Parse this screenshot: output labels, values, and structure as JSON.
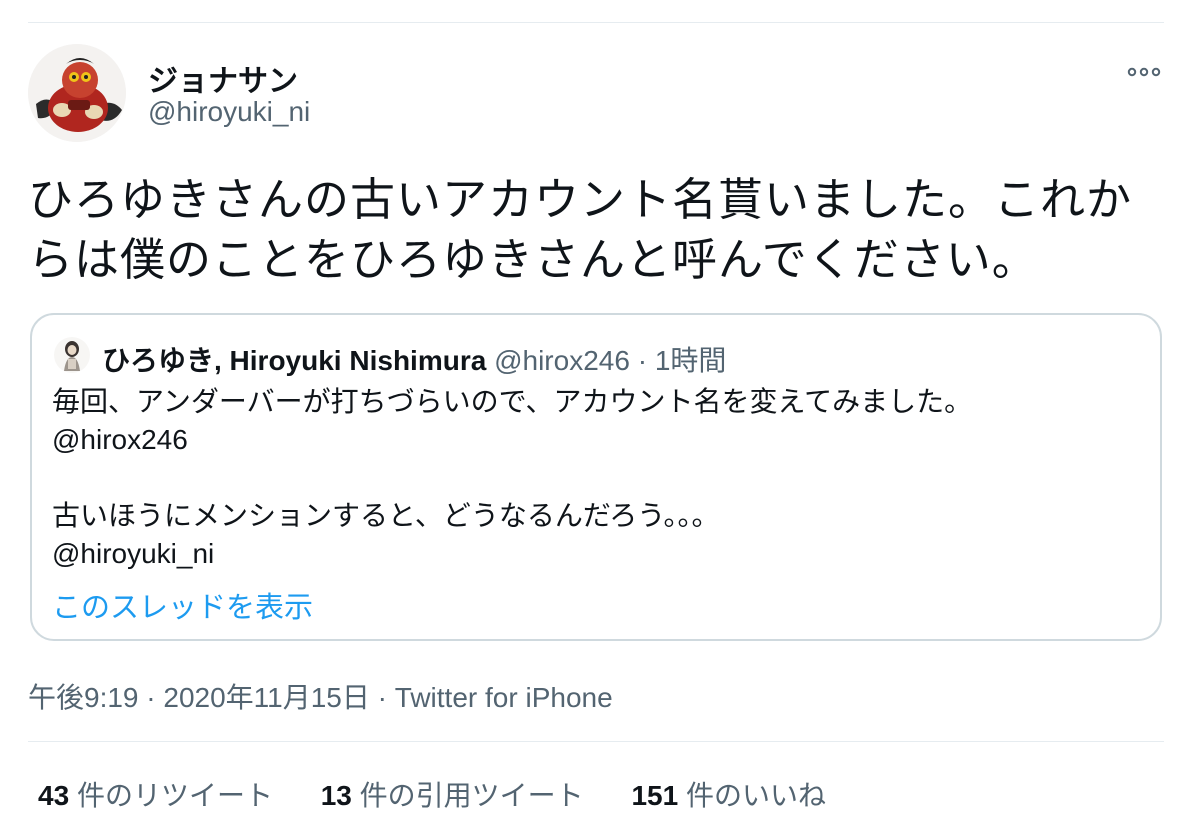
{
  "tweet": {
    "author_name": "ジョナサン",
    "author_handle": "@hiroyuki_ni",
    "more_icon": "more-horizontal-icon",
    "text_lines": [
      "ひろゆきさんの古いアカウント名貰いました。これか",
      "らは僕のことをひろゆきさんと呼んでください。"
    ],
    "timestamp": "午後9:19 · 2020年11月15日",
    "separator": "·",
    "source": "Twitter for iPhone"
  },
  "quote": {
    "author_name": "ひろゆき, Hiroyuki Nishimura",
    "author_handle": "@hirox246",
    "separator": "·",
    "time": "1時間",
    "lines": [
      "毎回、アンダーバーが打ちづらいので、アカウント名を変えてみました。",
      "@hirox246",
      "古いほうにメンションすると、どうなるんだろう。。。",
      "@hiroyuki_ni"
    ],
    "thread_link": "このスレッドを表示"
  },
  "stats": {
    "retweets_count": "43",
    "retweets_label": "件のリツイート",
    "quotes_count": "13",
    "quotes_label": "件の引用ツイート",
    "likes_count": "151",
    "likes_label": "件のいいね"
  },
  "colors": {
    "text": "#0f1419",
    "secondary": "#536471",
    "link": "#1d9bf0",
    "border": "#cfd9de"
  }
}
